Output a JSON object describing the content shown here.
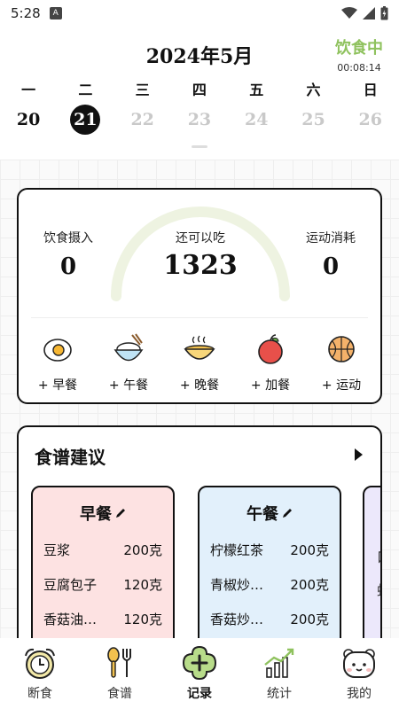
{
  "status_bar": {
    "time": "5:28",
    "badge": "A"
  },
  "header": {
    "month": "2024年5月",
    "fast_status": "饮食中",
    "fast_timer": "00:08:14"
  },
  "week": {
    "days": [
      "一",
      "二",
      "三",
      "四",
      "五",
      "六",
      "日"
    ],
    "dates": [
      "20",
      "21",
      "22",
      "23",
      "24",
      "25",
      "26"
    ],
    "selected_index": 1
  },
  "intake": {
    "eaten_label": "饮食摄入",
    "eaten_value": "0",
    "remaining_label": "还可以吃",
    "remaining_value": "1323",
    "burned_label": "运动消耗",
    "burned_value": "0",
    "meals": [
      {
        "label": "+ 早餐",
        "icon": "fried-egg-icon"
      },
      {
        "label": "+ 午餐",
        "icon": "rice-bowl-icon"
      },
      {
        "label": "+ 晚餐",
        "icon": "soup-bowl-icon"
      },
      {
        "label": "+ 加餐",
        "icon": "apple-icon"
      },
      {
        "label": "+ 运动",
        "icon": "basketball-icon"
      }
    ]
  },
  "recipes": {
    "title": "食谱建议",
    "breakfast": {
      "title": "早餐",
      "items": [
        {
          "name": "豆浆",
          "amount": "200克"
        },
        {
          "name": "豆腐包子",
          "amount": "120克"
        },
        {
          "name": "香菇油…",
          "amount": "120克"
        }
      ]
    },
    "lunch": {
      "title": "午餐",
      "items": [
        {
          "name": "柠檬红茶",
          "amount": "200克"
        },
        {
          "name": "青椒炒…",
          "amount": "200克"
        },
        {
          "name": "香菇炒…",
          "amount": "200克"
        }
      ]
    },
    "dinner_peek": [
      "口",
      "蛙"
    ]
  },
  "tabs": [
    {
      "label": "断食",
      "icon": "alarm-clock-icon"
    },
    {
      "label": "食谱",
      "icon": "utensils-icon"
    },
    {
      "label": "记录",
      "icon": "add-record-icon"
    },
    {
      "label": "统计",
      "icon": "stats-chart-icon"
    },
    {
      "label": "我的",
      "icon": "bear-face-icon"
    }
  ],
  "colors": {
    "accent_green": "#8fc25e",
    "highlight_yellow": "#f6df5e",
    "breakfast_bg": "#fde2e2",
    "lunch_bg": "#e2f0fb"
  }
}
